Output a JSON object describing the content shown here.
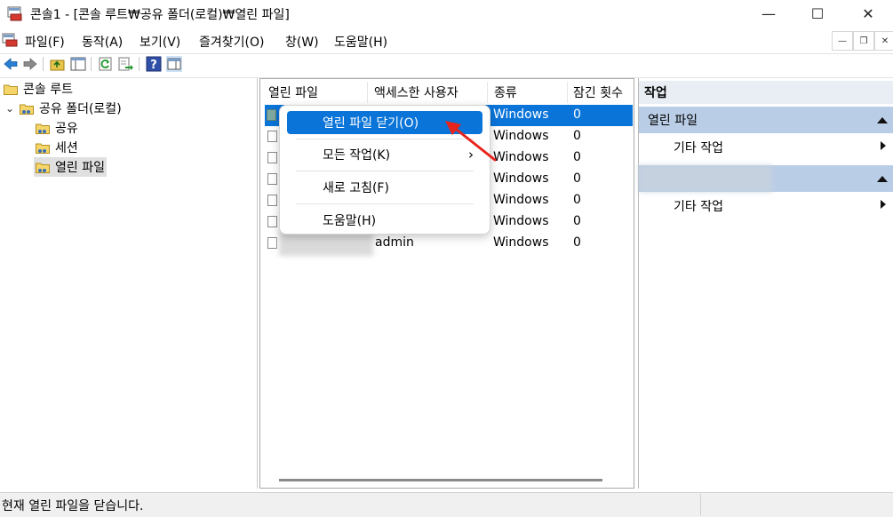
{
  "window": {
    "title": "콘솔1 - [콘솔 루트₩공유 폴더(로컬)₩열린 파일]",
    "minimize": "—",
    "maximize": "☐",
    "close": "✕"
  },
  "menubar": {
    "items": [
      "파일(F)",
      "동작(A)",
      "보기(V)",
      "즐겨찾기(O)",
      "창(W)",
      "도움말(H)"
    ],
    "mdi_minimize": "—",
    "mdi_restore": "❐",
    "mdi_close": "✕"
  },
  "toolbar": {
    "icons": [
      "back-icon",
      "forward-icon",
      "up-folder-icon",
      "show-hide-tree-icon",
      "refresh-icon",
      "export-list-icon",
      "help-icon",
      "show-hide-action-pane-icon"
    ]
  },
  "tree": {
    "root": "콘솔 루트",
    "shared_folders": "공유 폴더(로컬)",
    "shares": "공유",
    "sessions": "세션",
    "open_files": "열린 파일",
    "expander": "⌄"
  },
  "list": {
    "columns": [
      "열린 파일",
      "액세스한 사용자",
      "종류",
      "잠긴 횟수"
    ],
    "rows": [
      {
        "file": "",
        "user": "",
        "type": "Windows",
        "locks": "0",
        "selected": true
      },
      {
        "file": "",
        "user": "",
        "type": "Windows",
        "locks": "0",
        "selected": false
      },
      {
        "file": "",
        "user": "",
        "type": "Windows",
        "locks": "0",
        "selected": false
      },
      {
        "file": "",
        "user": "",
        "type": "Windows",
        "locks": "0",
        "selected": false
      },
      {
        "file": "",
        "user": "",
        "type": "Windows",
        "locks": "0",
        "selected": false
      },
      {
        "file": "",
        "user": "",
        "type": "Windows",
        "locks": "0",
        "selected": false
      },
      {
        "file": "",
        "user": "admin",
        "type": "Windows",
        "locks": "0",
        "selected": false
      }
    ]
  },
  "context_menu": {
    "items": [
      "열린 파일 닫기(O)",
      "모든 작업(K)",
      "새로 고침(F)",
      "도움말(H)"
    ],
    "submenu_arrow": "›"
  },
  "actions": {
    "header": "작업",
    "group1_title": "열린 파일",
    "group1_item": "기타 작업",
    "group2_item": "기타 작업"
  },
  "status": {
    "text": "현재 열린 파일을 닫습니다."
  },
  "colors": {
    "selection": "#0a74d8",
    "action_group": "#b9cde6",
    "arrow": "#e8231b"
  }
}
